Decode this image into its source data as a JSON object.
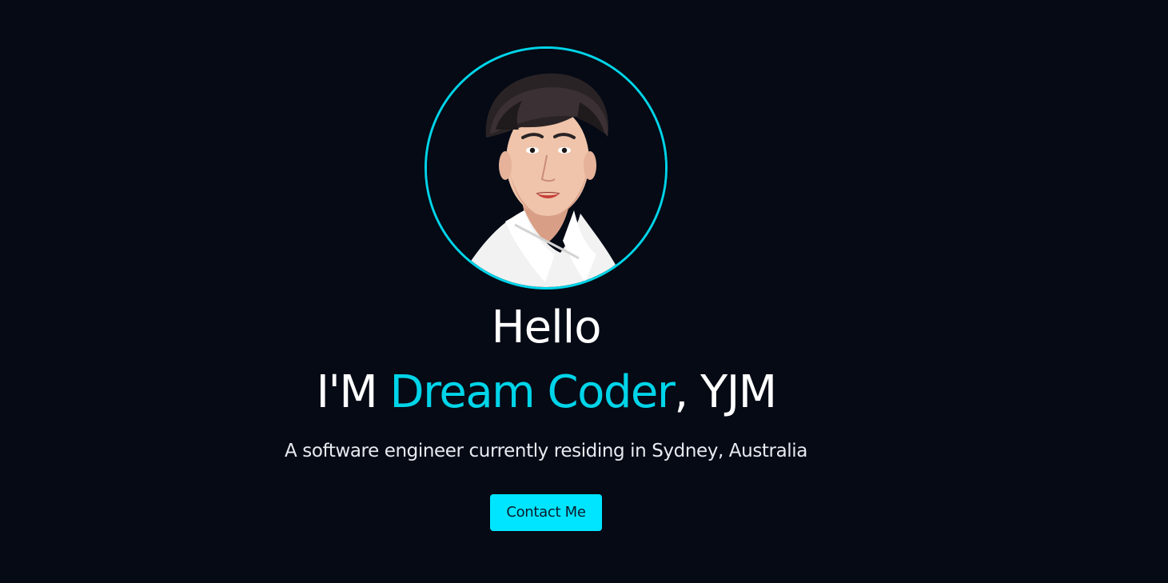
{
  "profile": {
    "avatar_alt": "profile photo",
    "greeting": "Hello",
    "intro_prefix": "I'M ",
    "intro_name": "Dream Coder",
    "intro_suffix": ", YJM",
    "description": "A software engineer currently residing in Sydney, Australia",
    "contact_button_label": "Contact Me"
  },
  "colors": {
    "background": "#050a15",
    "accent": "#00d4e8",
    "button": "#00e5ff",
    "text": "#ffffff"
  }
}
